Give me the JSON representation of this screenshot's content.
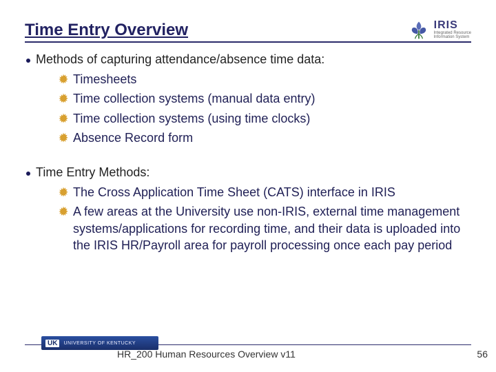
{
  "title": "Time Entry Overview",
  "logo": {
    "name": "IRIS",
    "sub1": "Integrated Resource",
    "sub2": "Information System"
  },
  "sections": [
    {
      "lead": "Methods of capturing attendance/absence time data:",
      "items": [
        "Timesheets",
        "Time collection systems (manual data entry)",
        "Time collection systems (using time clocks)",
        "Absence Record form"
      ]
    },
    {
      "lead": "Time Entry Methods:",
      "items": [
        "The Cross Application Time Sheet (CATS) interface in IRIS",
        "A few areas at the University use non-IRIS, external time management systems/applications for recording time, and their data is uploaded into the IRIS HR/Payroll area for payroll processing once each pay period"
      ]
    }
  ],
  "footer": {
    "badge_uk": "UK",
    "badge_uni": "UNIVERSITY OF KENTUCKY",
    "text": "HR_200 Human Resources Overview v11",
    "page": "56"
  }
}
